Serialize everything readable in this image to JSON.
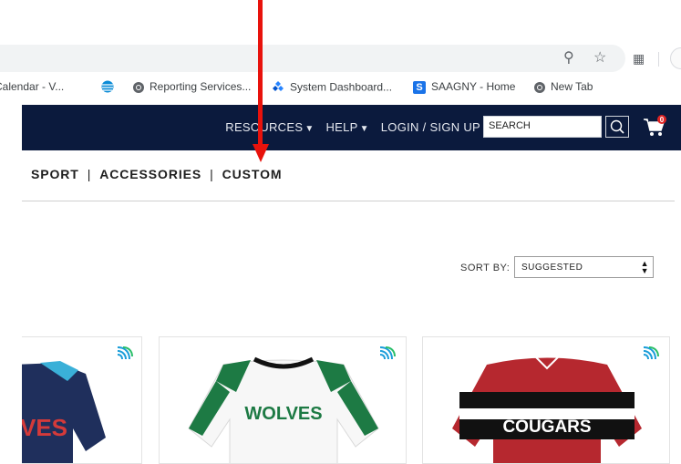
{
  "bookmarks": [
    {
      "label": "Calendar - V...",
      "icon": "calendar-favicon"
    },
    {
      "label": "",
      "icon": "att-globe-icon"
    },
    {
      "label": "Reporting Services...",
      "icon": "globe-icon"
    },
    {
      "label": "System Dashboard...",
      "icon": "jira-icon"
    },
    {
      "label": "SAAGNY - Home",
      "icon": "sharepoint-icon"
    },
    {
      "label": "New Tab",
      "icon": "globe-icon"
    }
  ],
  "header": {
    "resources": "RESOURCES",
    "help": "HELP",
    "login": "LOGIN / SIGN UP",
    "search_value": "SEARCH",
    "cart_count": "0"
  },
  "catnav": [
    "SPORT",
    "ACCESSORIES",
    "CUSTOM"
  ],
  "sort": {
    "label": "SORT BY:",
    "value": "SUGGESTED"
  },
  "products": [
    {
      "jersey_text": "VES",
      "colors": {
        "body": "#1f2f5c",
        "trim": "#3ab0d8",
        "text": "#d43a3a"
      }
    },
    {
      "jersey_text": "WOLVES",
      "colors": {
        "body": "#f7f7f7",
        "trim": "#1d7a44",
        "text": "#1d7a44"
      }
    },
    {
      "jersey_text": "COUGARS",
      "colors": {
        "body": "#b6282f",
        "trim": "#111111",
        "text": "#ffffff"
      }
    }
  ],
  "annotation_color": "#e8120c"
}
